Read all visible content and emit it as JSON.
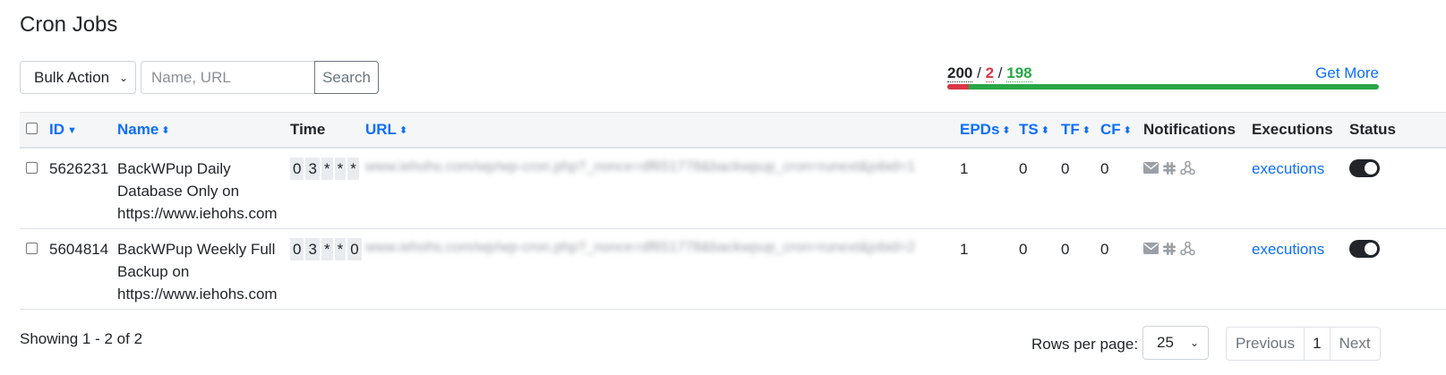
{
  "page": {
    "title": "Cron Jobs"
  },
  "toolbar": {
    "bulk_action": "Bulk Action",
    "search_placeholder": "Name, URL",
    "search_label": "Search"
  },
  "quota": {
    "total": "200",
    "failed": "2",
    "ok": "198",
    "separator": "/",
    "get_more": "Get More",
    "failed_fraction": 0.01
  },
  "table": {
    "headers": {
      "id": "ID",
      "name": "Name",
      "time": "Time",
      "url": "URL",
      "epds": "EPDs",
      "ts": "TS",
      "tf": "TF",
      "cf": "CF",
      "notifications": "Notifications",
      "executions": "Executions",
      "status": "Status"
    },
    "rows": [
      {
        "id": "5626231",
        "name": "BackWPup Daily Database Only on https://www.iehohs.com",
        "time": [
          "0",
          "3",
          "*",
          "*",
          "*"
        ],
        "url": "www.iehohs.com/wp/wp-cron.php?_nonce=df651778&backwpup_cron=runext&jobid=1",
        "epds": "1",
        "ts": "0",
        "tf": "0",
        "cf": "0",
        "executions": "executions",
        "status_on": true
      },
      {
        "id": "5604814",
        "name": "BackWPup Weekly Full Backup on https://www.iehohs.com",
        "time": [
          "0",
          "3",
          "*",
          "*",
          "0"
        ],
        "url": "www.iehohs.com/wp/wp-cron.php?_nonce=df651778&backwpup_cron=runext&jobid=2",
        "epds": "1",
        "ts": "0",
        "tf": "0",
        "cf": "0",
        "executions": "executions",
        "status_on": true
      }
    ]
  },
  "icons": {
    "notifications": [
      "envelope-icon",
      "slack-icon",
      "webhook-icon"
    ],
    "sort_desc": "sort-desc-icon",
    "sort_both": "sort-icon"
  },
  "footer": {
    "showing": "Showing 1 - 2 of 2",
    "rows_per_page_label": "Rows per page:",
    "rows_per_page": "25",
    "previous": "Previous",
    "page": "1",
    "next": "Next"
  },
  "colors": {
    "link": "#0d6efd",
    "failed": "#dc3545",
    "ok": "#28a745"
  }
}
